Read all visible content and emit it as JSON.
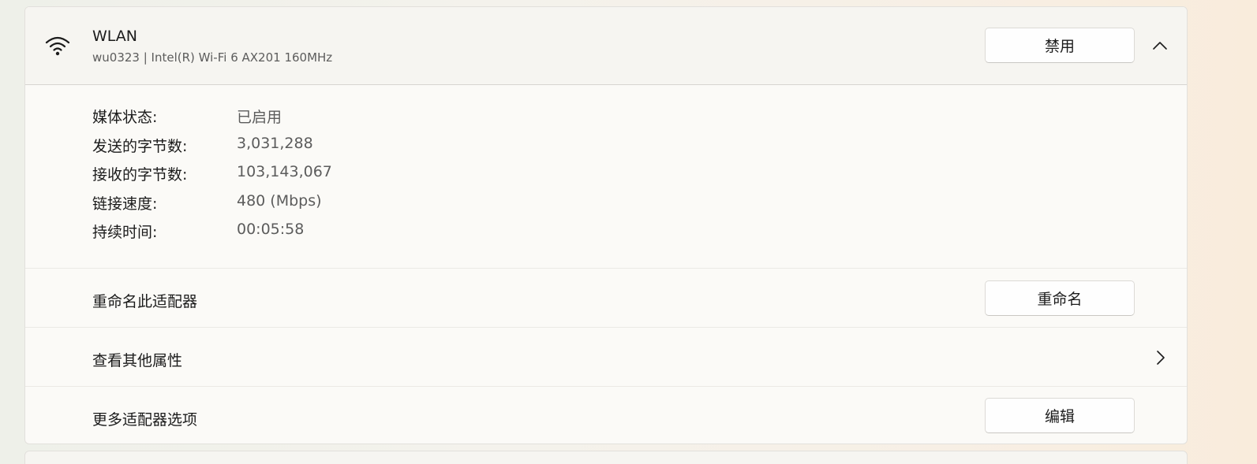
{
  "adapter": {
    "icon": "wifi-icon",
    "name": "WLAN",
    "description": "wu0323 | Intel(R) Wi-Fi 6 AX201 160MHz",
    "disable_label": "禁用",
    "collapse_icon": "chevron-up-icon"
  },
  "details": [
    {
      "label": "媒体状态:",
      "value": "已启用"
    },
    {
      "label": "发送的字节数:",
      "value": "3,031,288"
    },
    {
      "label": "接收的字节数:",
      "value": "103,143,067"
    },
    {
      "label": "链接速度:",
      "value": "480 (Mbps)"
    },
    {
      "label": "持续时间:",
      "value": "00:05:58"
    }
  ],
  "rename": {
    "label": "重命名此适配器",
    "button": "重命名"
  },
  "properties": {
    "label": "查看其他属性",
    "icon": "chevron-right-icon"
  },
  "more_options": {
    "label": "更多适配器选项",
    "button": "编辑"
  }
}
